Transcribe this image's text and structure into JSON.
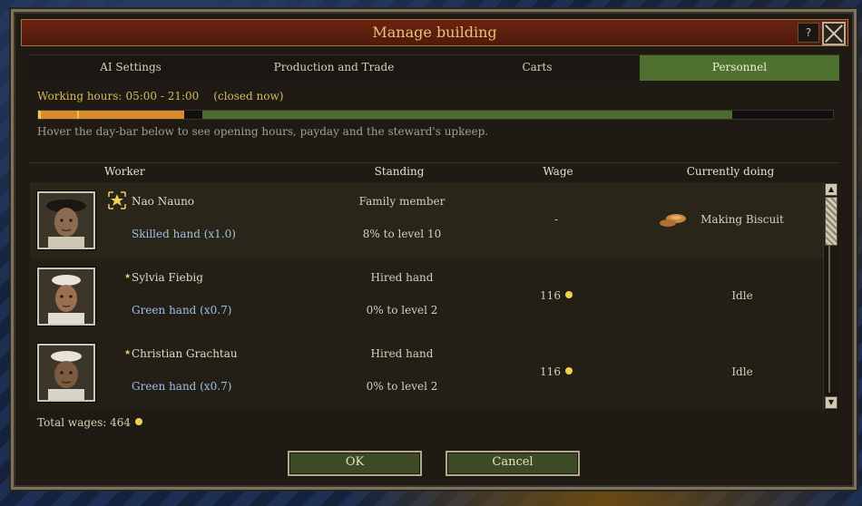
{
  "window": {
    "title": "Manage building",
    "help_label": "?"
  },
  "tabs": [
    {
      "label": "AI Settings"
    },
    {
      "label": "Production and Trade"
    },
    {
      "label": "Carts"
    },
    {
      "label": "Personnel"
    }
  ],
  "active_tab": "Personnel",
  "hours": {
    "label": "Working hours:",
    "range": "05:00 - 21:00",
    "status": "(closed now)"
  },
  "daybar": {
    "open_from_hour": 5,
    "open_to_hour": 21,
    "current_hour": 1
  },
  "hint": "Hover the day-bar below to see opening hours, payday and the steward's upkeep.",
  "columns": {
    "worker": "Worker",
    "standing": "Standing",
    "wage": "Wage",
    "doing": "Currently doing"
  },
  "workers": [
    {
      "name": "Nao Nauno",
      "skill": "Skilled hand  (x1.0)",
      "standing": "Family member",
      "progress": "8% to level 10",
      "wage": "-",
      "doing": "Making Biscuit",
      "icon": "steward-badge-icon"
    },
    {
      "name": "Sylvia Fiebig",
      "skill": "Green hand  (x0.7)",
      "standing": "Hired hand",
      "progress": "0% to level 2",
      "wage": "116",
      "doing": "Idle",
      "icon": "small-star-icon"
    },
    {
      "name": "Christian Grachtau",
      "skill": "Green hand  (x0.7)",
      "standing": "Hired hand",
      "progress": "0% to level 2",
      "wage": "116",
      "doing": "Idle",
      "icon": "small-star-icon"
    }
  ],
  "total": {
    "label": "Total wages: 464"
  },
  "buttons": {
    "ok": "OK",
    "cancel": "Cancel"
  },
  "colors": {
    "active_tab": "#4f7130",
    "title_bar": "#5a1e0c",
    "bar_open": "#4e6b30",
    "bar_closed": "#d98c2a",
    "coin": "#f0d050"
  }
}
